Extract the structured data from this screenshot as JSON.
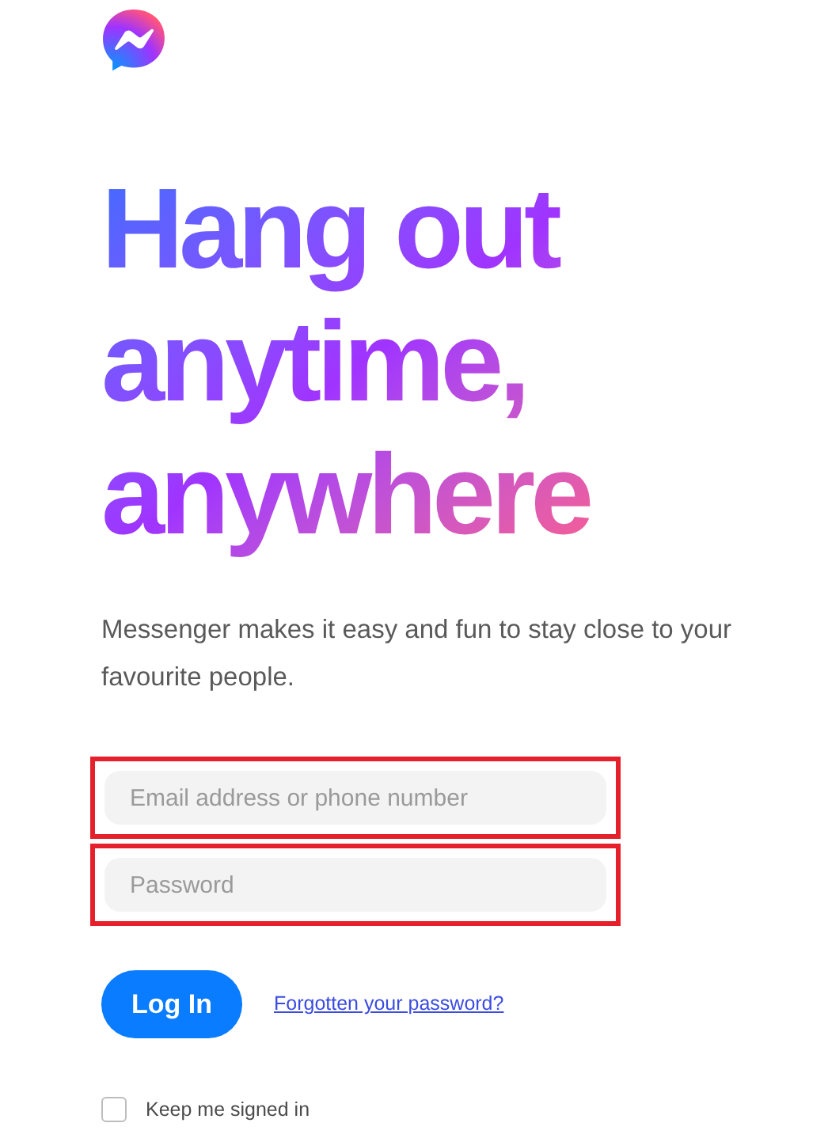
{
  "heading": "Hang out anytime, anywhere",
  "subtitle": "Messenger makes it easy and fun to stay close to your favourite people.",
  "fields": [
    {
      "placeholder": "Email address or phone number",
      "highlighted": true
    },
    {
      "placeholder": "Password",
      "highlighted": true
    }
  ],
  "login_button": "Log In",
  "forgot_link": "Forgotten your password?",
  "keep_signed_in": {
    "label": "Keep me signed in",
    "checked": false
  }
}
